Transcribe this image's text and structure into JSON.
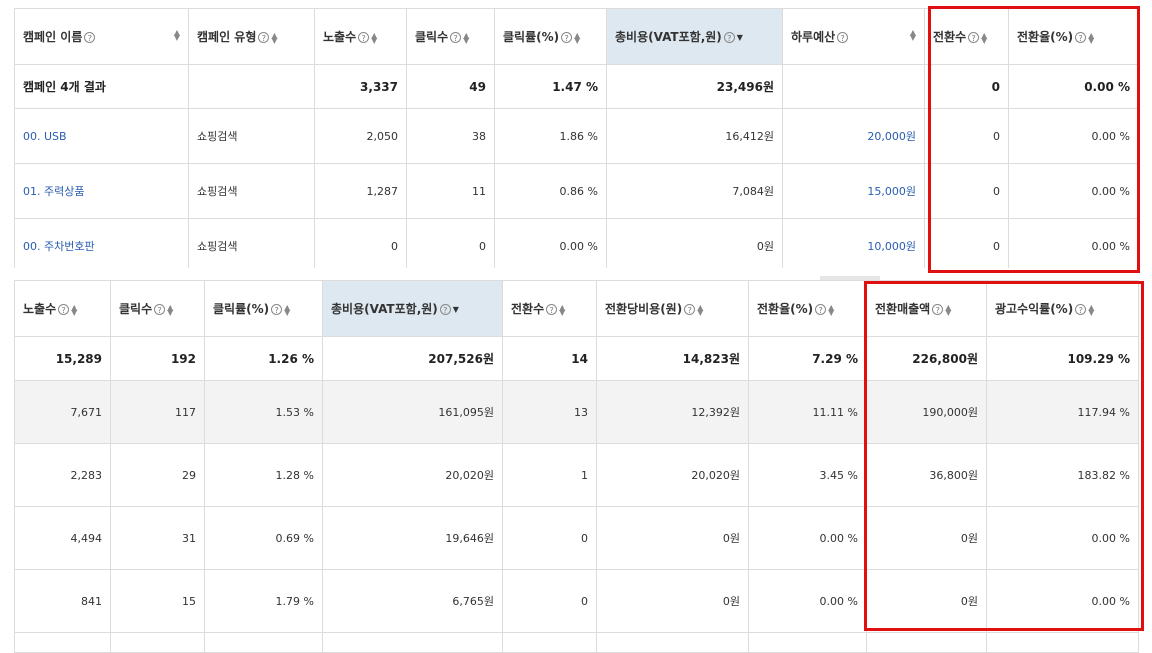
{
  "t1": {
    "headers": [
      "캠페인 이름",
      "캠페인 유형",
      "노출수",
      "클릭수",
      "클릭률(%)",
      "총비용(VAT포함,원)",
      "하루예산",
      "전환수",
      "전환율(%)"
    ],
    "summary": [
      "캠페인 4개 결과",
      "",
      "3,337",
      "49",
      "1.47 %",
      "23,496원",
      "",
      "0",
      "0.00 %"
    ],
    "rows": [
      [
        "00. USB",
        "쇼핑검색",
        "2,050",
        "38",
        "1.86 %",
        "16,412원",
        "20,000원",
        "0",
        "0.00 %"
      ],
      [
        "01. 주력상품",
        "쇼핑검색",
        "1,287",
        "11",
        "0.86 %",
        "7,084원",
        "15,000원",
        "0",
        "0.00 %"
      ],
      [
        "00. 주차번호판",
        "쇼핑검색",
        "0",
        "0",
        "0.00 %",
        "0원",
        "10,000원",
        "0",
        "0.00 %"
      ]
    ]
  },
  "t2": {
    "headers": [
      "노출수",
      "클릭수",
      "클릭률(%)",
      "총비용(VAT포함,원)",
      "전환수",
      "전환당비용(원)",
      "전환율(%)",
      "전환매출액",
      "광고수익률(%)"
    ],
    "summary": [
      "15,289",
      "192",
      "1.26 %",
      "207,526원",
      "14",
      "14,823원",
      "7.29 %",
      "226,800원",
      "109.29 %"
    ],
    "rows": [
      [
        "7,671",
        "117",
        "1.53 %",
        "161,095원",
        "13",
        "12,392원",
        "11.11 %",
        "190,000원",
        "117.94 %"
      ],
      [
        "2,283",
        "29",
        "1.28 %",
        "20,020원",
        "1",
        "20,020원",
        "3.45 %",
        "36,800원",
        "183.82 %"
      ],
      [
        "4,494",
        "31",
        "0.69 %",
        "19,646원",
        "0",
        "0원",
        "0.00 %",
        "0원",
        "0.00 %"
      ],
      [
        "841",
        "15",
        "1.79 %",
        "6,765원",
        "0",
        "0원",
        "0.00 %",
        "0원",
        "0.00 %"
      ]
    ]
  },
  "icons": {
    "help": "?",
    "sort": "sort-up-down-icon",
    "caret": "caret-down-icon"
  },
  "colors": {
    "link": "#2a5db0",
    "highlight": "#e01010",
    "sorted_header": "#dde8f0"
  }
}
